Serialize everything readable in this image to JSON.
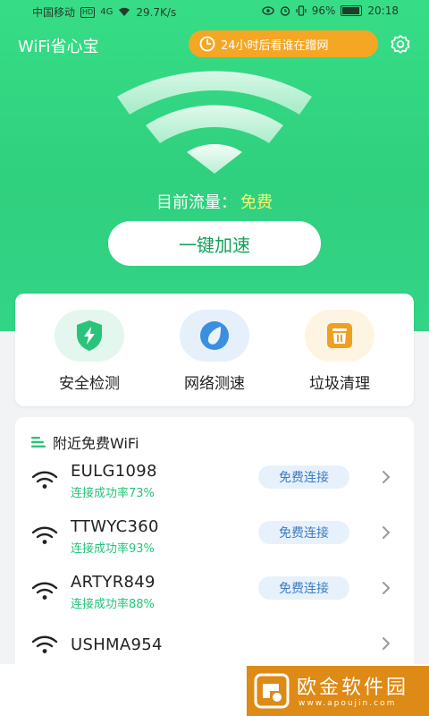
{
  "status_bar": {
    "carrier": "中国移动",
    "network_badge": "HD",
    "signal": "4G",
    "speed": "29.7K/s",
    "battery": "96%",
    "time": "20:18"
  },
  "header": {
    "app_title": "WiFi省心宝",
    "promo_label": "24小时后看谁在蹭网",
    "promo_icon": "clock-icon",
    "settings_icon": "gear-icon"
  },
  "hero": {
    "traffic_label": "目前流量：",
    "traffic_value": "免费",
    "boost_button": "一键加速"
  },
  "tools": [
    {
      "label": "安全检测",
      "icon": "shield-bolt-icon",
      "bg": "#e3f7ee",
      "color": "#29c37a"
    },
    {
      "label": "网络测速",
      "icon": "speed-drop-icon",
      "bg": "#e6f0fb",
      "color": "#3b8fe0"
    },
    {
      "label": "垃圾清理",
      "icon": "trash-icon",
      "bg": "#fdf5e2",
      "color": "#f0a020"
    }
  ],
  "nearby": {
    "title": "附近免费WiFi",
    "items": [
      {
        "ssid": "EULG1098",
        "rate": "连接成功率73%",
        "action": "免费连接"
      },
      {
        "ssid": "TTWYC360",
        "rate": "连接成功率93%",
        "action": "免费连接"
      },
      {
        "ssid": "ARTYR849",
        "rate": "连接成功率88%",
        "action": "免费连接"
      },
      {
        "ssid": "USHMA954",
        "rate": "",
        "action": ""
      }
    ]
  },
  "watermark": {
    "title": "欧金软件园",
    "url": "www.apoujin.com"
  },
  "colors": {
    "brand_green": "#33d487",
    "promo_orange": "#f5a623",
    "rate_green": "#26c37a",
    "connect_blue": "#3d7cc4"
  }
}
